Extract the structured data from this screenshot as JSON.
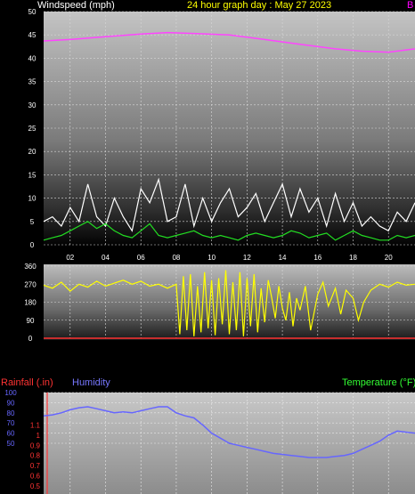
{
  "header": {
    "wind_label": "Windspeed (mph)",
    "title": "24 hour graph day : May 27 2023",
    "corner_letter": "B"
  },
  "lower_header": {
    "rain_label": "Rainfall (.in)",
    "humidity_label": "Humidity",
    "temp_label": "Temperature (°F)"
  },
  "colors": {
    "wind_label": "#ffffff",
    "title": "#ffff00",
    "corner": "#ff00ff",
    "pressure": "#ff44ff",
    "gust": "#ffffff",
    "average": "#22dd22",
    "direction": "#ffff00",
    "rain": "#ff3333",
    "humidity": "#6666ff",
    "temperature": "#33ff33"
  },
  "chart_data": [
    {
      "type": "line",
      "name": "wind",
      "xlim": [
        0.5,
        21.5
      ],
      "ylim": [
        0,
        50
      ],
      "y_ticks": [
        0,
        5,
        10,
        15,
        20,
        25,
        30,
        35,
        40,
        45,
        50
      ],
      "x_ticks": [
        "02",
        "04",
        "06",
        "08",
        "10",
        "12",
        "14",
        "16",
        "18",
        "20"
      ],
      "x_tick_values": [
        2,
        4,
        6,
        8,
        10,
        12,
        14,
        16,
        18,
        20
      ],
      "grid": true,
      "series": [
        {
          "role": "pressure",
          "x": [
            0.5,
            2,
            4,
            6,
            7.5,
            9,
            11,
            13,
            15,
            17,
            18.5,
            20,
            21.5
          ],
          "y": [
            43.7,
            44.0,
            44.6,
            45.2,
            45.5,
            45.3,
            45.0,
            44.0,
            43.0,
            42.0,
            41.5,
            41.3,
            42.0
          ]
        },
        {
          "role": "gust",
          "x": [
            0.5,
            1.0,
            1.5,
            2.0,
            2.5,
            3.0,
            3.5,
            4.0,
            4.5,
            5.0,
            5.5,
            6.0,
            6.5,
            7.0,
            7.5,
            8.0,
            8.5,
            9.0,
            9.5,
            10.0,
            10.5,
            11.0,
            11.5,
            12.0,
            12.5,
            13.0,
            13.5,
            14.0,
            14.5,
            15.0,
            15.5,
            16.0,
            16.5,
            17.0,
            17.5,
            18.0,
            18.5,
            19.0,
            19.5,
            20.0,
            20.5,
            21.0,
            21.5
          ],
          "y": [
            5,
            6,
            4,
            8,
            5,
            13,
            6,
            4,
            10,
            6,
            3,
            12,
            9,
            14,
            5,
            6,
            13,
            4,
            10,
            5,
            9,
            12,
            6,
            8,
            11,
            5,
            9,
            13,
            6,
            12,
            7,
            10,
            4,
            11,
            5,
            9,
            4,
            6,
            4,
            3,
            7,
            5,
            9
          ]
        },
        {
          "role": "average",
          "x": [
            0.5,
            1.0,
            1.5,
            2.0,
            2.5,
            3.0,
            3.5,
            4.0,
            4.5,
            5.0,
            5.5,
            6.0,
            6.5,
            7.0,
            7.5,
            8.0,
            8.5,
            9.0,
            9.5,
            10.0,
            10.5,
            11.0,
            11.5,
            12.0,
            12.5,
            13.0,
            13.5,
            14.0,
            14.5,
            15.0,
            15.5,
            16.0,
            16.5,
            17.0,
            17.5,
            18.0,
            18.5,
            19.0,
            19.5,
            20.0,
            20.5,
            21.0,
            21.5
          ],
          "y": [
            1,
            1.5,
            2,
            3,
            4,
            5,
            3.5,
            4.5,
            3,
            2,
            1.5,
            3,
            4.5,
            2,
            1.5,
            2,
            2.5,
            3,
            2,
            1.5,
            2,
            1.5,
            1,
            2,
            2.5,
            2,
            1.5,
            2,
            3,
            2.5,
            1.5,
            2,
            2.5,
            1,
            2,
            3,
            2,
            1.5,
            1,
            1,
            2,
            1.5,
            2
          ]
        }
      ]
    },
    {
      "type": "line",
      "name": "wind-direction",
      "xlim": [
        0.5,
        21.5
      ],
      "ylim": [
        0,
        360
      ],
      "y_ticks": [
        0,
        90,
        180,
        270,
        360
      ],
      "grid": true,
      "series": [
        {
          "role": "direction",
          "x": [
            0.5,
            1.0,
            1.5,
            2.0,
            2.5,
            3.0,
            3.5,
            4.0,
            4.5,
            5.0,
            5.5,
            6.0,
            6.5,
            7.0,
            7.5,
            8.0,
            8.2,
            8.4,
            8.6,
            8.8,
            9.0,
            9.2,
            9.4,
            9.6,
            9.8,
            10.0,
            10.2,
            10.4,
            10.6,
            10.8,
            11.0,
            11.2,
            11.4,
            11.6,
            11.8,
            12.0,
            12.2,
            12.4,
            12.6,
            12.8,
            13.0,
            13.2,
            13.4,
            13.6,
            13.8,
            14.0,
            14.2,
            14.4,
            14.6,
            14.8,
            15.0,
            15.3,
            15.6,
            16.0,
            16.3,
            16.6,
            17.0,
            17.3,
            17.6,
            18.0,
            18.3,
            18.6,
            19.0,
            19.5,
            20.0,
            20.5,
            21.0,
            21.5
          ],
          "y": [
            265,
            250,
            280,
            235,
            270,
            255,
            285,
            260,
            275,
            290,
            270,
            285,
            260,
            270,
            250,
            270,
            20,
            310,
            40,
            320,
            10,
            260,
            30,
            330,
            50,
            290,
            15,
            300,
            70,
            340,
            20,
            280,
            40,
            330,
            10,
            300,
            60,
            320,
            30,
            250,
            80,
            290,
            200,
            100,
            260,
            150,
            90,
            230,
            60,
            200,
            140,
            260,
            40,
            220,
            280,
            160,
            250,
            120,
            240,
            200,
            90,
            180,
            240,
            270,
            255,
            280,
            265,
            270
          ]
        }
      ]
    },
    {
      "type": "line",
      "name": "rain-humidity-temperature",
      "xlim": [
        0.5,
        21.5
      ],
      "ylim": [
        0,
        100
      ],
      "rain_ticks": [
        0.5,
        0.6,
        0.7,
        0.8,
        0.9,
        1,
        1.1
      ],
      "humidity_ticks": [
        50,
        60,
        70,
        80,
        90,
        100
      ],
      "grid": true,
      "series": [
        {
          "role": "humidity",
          "x": [
            0.5,
            1.0,
            1.5,
            2.0,
            2.5,
            3.0,
            3.5,
            4.0,
            4.5,
            5.0,
            5.5,
            6.0,
            6.5,
            7.0,
            7.5,
            8.0,
            8.5,
            9.0,
            9.5,
            10.0,
            10.5,
            11.0,
            11.5,
            12.0,
            12.5,
            13.0,
            13.5,
            14.0,
            14.5,
            15.0,
            15.5,
            16.0,
            16.5,
            17.0,
            17.5,
            18.0,
            18.5,
            19.0,
            19.5,
            20.0,
            20.5,
            21.0,
            21.5
          ],
          "y": [
            77,
            78,
            80,
            83,
            85,
            86,
            84,
            82,
            80,
            81,
            80,
            82,
            84,
            86,
            86,
            80,
            77,
            75,
            68,
            60,
            55,
            50,
            48,
            46,
            44,
            42,
            40,
            39,
            38,
            37,
            36,
            36,
            36,
            37,
            38,
            40,
            44,
            48,
            52,
            58,
            62,
            61,
            60
          ]
        }
      ]
    }
  ]
}
